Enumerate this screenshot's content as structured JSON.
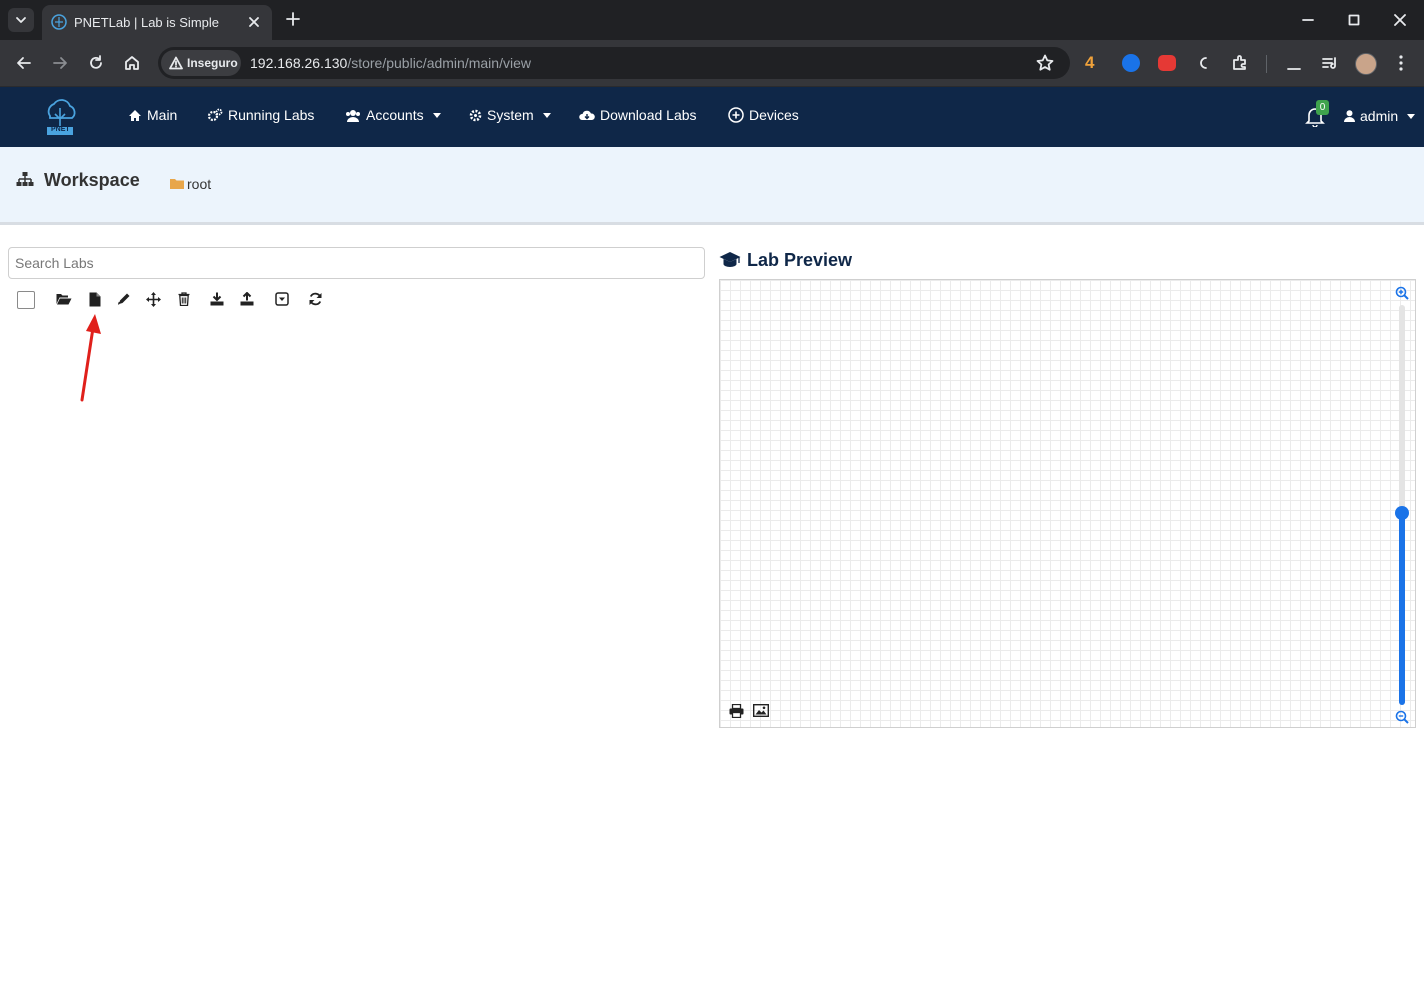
{
  "browser": {
    "tab_title": "PNETLab | Lab is Simple",
    "security_label": "Inseguro",
    "url_host": "192.168.26.130",
    "url_path": "/store/public/admin/main/view",
    "extension_badge": "4"
  },
  "nav": {
    "main": "Main",
    "running_labs": "Running Labs",
    "accounts": "Accounts",
    "system": "System",
    "download_labs": "Download Labs",
    "devices": "Devices",
    "notification_count": "0",
    "user": "admin",
    "logo_text": "PNET"
  },
  "workspace": {
    "title": "Workspace",
    "folder": "root"
  },
  "search": {
    "placeholder": "Search Labs"
  },
  "preview": {
    "title": "Lab Preview",
    "zoom_level": 0.48
  },
  "colors": {
    "navbar": "#0f2748",
    "header_bg": "#ecf4fc",
    "accent": "#1a73e8",
    "folder": "#e8a64a",
    "arrow": "#e0201b"
  }
}
